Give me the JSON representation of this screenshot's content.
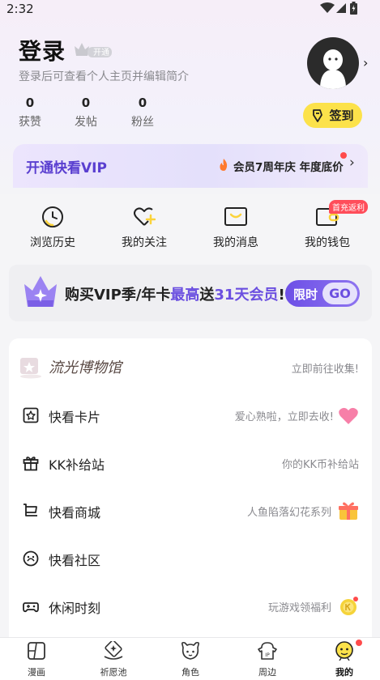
{
  "status_bar": {
    "time": "2:32"
  },
  "profile": {
    "title": "登录",
    "level_badge": "开通",
    "subtitle": "登录后可查看个人主页并编辑简介",
    "stats": [
      {
        "value": "0",
        "label": "获赞"
      },
      {
        "value": "0",
        "label": "发帖"
      },
      {
        "value": "0",
        "label": "粉丝"
      }
    ],
    "checkin_label": "签到",
    "chevron": "›"
  },
  "vip": {
    "title": "开通快看VIP",
    "promo": "会员7周年庆 年度底价",
    "chevron": "›"
  },
  "quick_actions": [
    {
      "label": "浏览历史",
      "icon": "clock-icon"
    },
    {
      "label": "我的关注",
      "icon": "heart-plus-icon"
    },
    {
      "label": "我的消息",
      "icon": "message-icon"
    },
    {
      "label": "我的钱包",
      "icon": "wallet-icon",
      "badge": "首充返利"
    }
  ],
  "promo": {
    "text_a": "购买VIP季/年卡",
    "text_hl1": "最高",
    "text_b": "送",
    "text_hl2": "31天会员",
    "text_c": "!",
    "go_prefix": "限时",
    "go_label": "GO"
  },
  "list": [
    {
      "title": "流光博物馆",
      "subtitle": "立即前往收集!",
      "icon": "museum-icon"
    },
    {
      "title": "快看卡片",
      "subtitle": "爱心熟啦，立即去收!",
      "icon": "card-icon"
    },
    {
      "title": "KK补给站",
      "subtitle": "你的KK币补给站",
      "icon": "gift-box-icon"
    },
    {
      "title": "快看商城",
      "subtitle": "人鱼陷落幻花系列",
      "icon": "cart-icon"
    },
    {
      "title": "快看社区",
      "subtitle": "",
      "icon": "community-icon"
    },
    {
      "title": "休闲时刻",
      "subtitle": "玩游戏领福利",
      "icon": "gamepad-icon"
    }
  ],
  "tabs": [
    {
      "label": "漫画",
      "icon": "comic-icon"
    },
    {
      "label": "祈愿池",
      "icon": "wish-pool-icon"
    },
    {
      "label": "角色",
      "icon": "character-icon"
    },
    {
      "label": "周边",
      "icon": "merch-icon"
    },
    {
      "label": "我的",
      "icon": "me-icon",
      "active": true
    }
  ],
  "colors": {
    "accent": "#6b4fe0",
    "checkin": "#fce24a",
    "badge_red": "#ff4d5a"
  }
}
